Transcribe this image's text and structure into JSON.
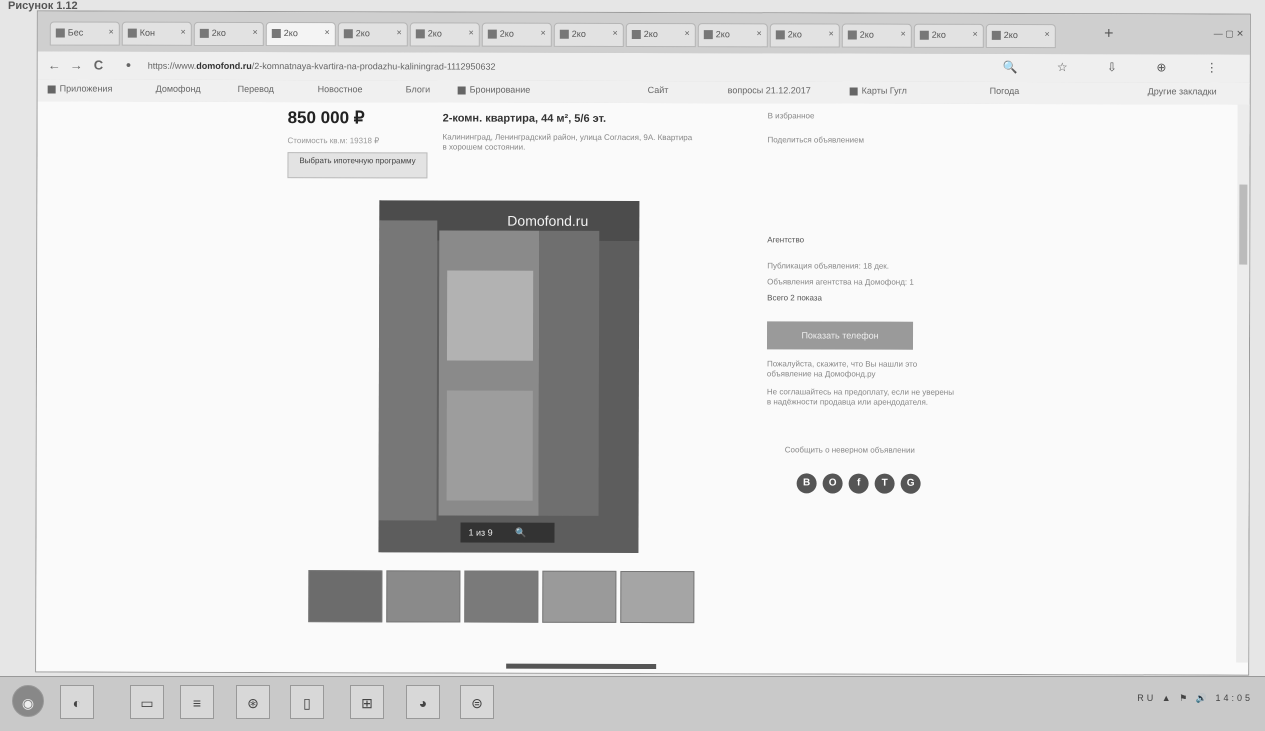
{
  "page_note": "Рисунок 1.12",
  "browser": {
    "tabs": [
      {
        "label": "Бес"
      },
      {
        "label": "Кон"
      },
      {
        "label": "2ко"
      },
      {
        "label": "2ко"
      },
      {
        "label": "2ко"
      },
      {
        "label": "2ко"
      },
      {
        "label": "2ко"
      },
      {
        "label": "2ко"
      },
      {
        "label": "2ко"
      },
      {
        "label": "2ко"
      },
      {
        "label": "2ко"
      },
      {
        "label": "2ко"
      },
      {
        "label": "2ко"
      },
      {
        "label": "2ко"
      }
    ],
    "tab_close": "×",
    "new_tab": "+",
    "window_buttons": "— ▢ ✕",
    "back": "←",
    "forward": "→",
    "reload": "C",
    "url_prefix": "https://www.",
    "url_domain": "domofond.ru",
    "url_rest": "/2-komnatnaya-kvartira-na-prodazhu-kaliningrad-1112950632",
    "toolbar_icons": "🔍 ☆ ⇩ ⊕ ⋮",
    "bookmarks": [
      {
        "label": "Приложения"
      },
      {
        "label": "Домофонд"
      },
      {
        "label": "Перевод"
      },
      {
        "label": "Новостное"
      },
      {
        "label": "Блоги"
      },
      {
        "label": "Бронирование"
      },
      {
        "label": "Сайт"
      },
      {
        "label": "вопросы 21.12.2017"
      },
      {
        "label": "Карты Гугл"
      },
      {
        "label": "Погода"
      },
      {
        "label": "Другие закладки"
      }
    ]
  },
  "listing": {
    "price": "850 000 ₽",
    "price_sub": "Стоимость кв.м: 19318 ₽",
    "price_button": "Выбрать ипотечную программу",
    "title": "2-комн. квартира, 44 м², 5/6 эт.",
    "description": "Калининград, Ленинградский район, улица Согласия, 9А. Квартира в хорошем состоянии.",
    "watermark": "Domofond.ru",
    "image_bar_photos": "1 из 9",
    "image_bar_zoom": "🔍",
    "right": {
      "favorites": "В избранное",
      "share": "Поделиться объявлением",
      "owner_label": "Агентство",
      "published": "Публикация объявления: 18 дек.",
      "other_listings": "Объявления агентства на Домофонд: 1",
      "views": "Всего 2 показа",
      "call_button": "Показать телефон",
      "note1": "Пожалуйста, скажите, что Вы нашли это объявление на Домофонд.ру",
      "note2": "Не соглашайтесь на предоплату, если не уверены в надёжности продавца или арендодателя.",
      "report": "Сообщить о неверном объявлении",
      "social": [
        "В",
        "О",
        "f",
        "Т",
        "G"
      ]
    }
  },
  "taskbar": {
    "items": [
      "◉",
      "◐",
      "▭",
      "≡",
      "⊛",
      "▯",
      "⊞",
      "◕",
      "⊜"
    ],
    "tray": "RU ▲ ⚑ 🔊 14:05"
  }
}
